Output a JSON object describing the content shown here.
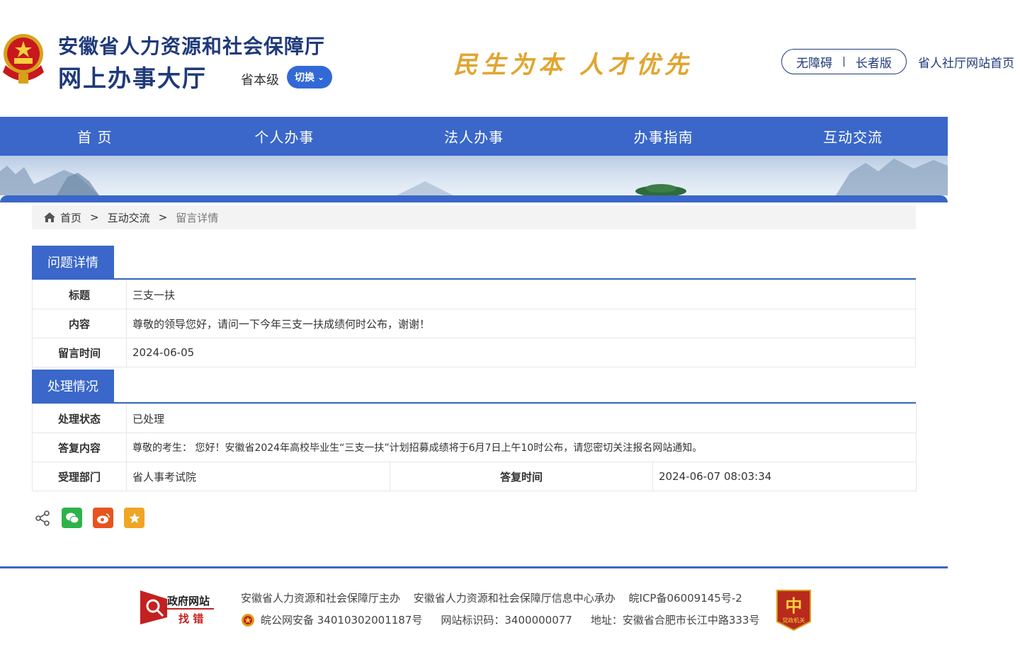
{
  "header": {
    "title_line1": "安徽省人力资源和社会保障厅",
    "title_line2": "网上办事大厅",
    "level_label": "省本级",
    "switch_label": "切换",
    "slogan": "民生为本 人才优先",
    "accessibility_label": "无障碍",
    "elder_label": "长者版",
    "site_home_link": "省人社厅网站首页"
  },
  "nav": {
    "items": [
      "首 页",
      "个人办事",
      "法人办事",
      "办事指南",
      "互动交流"
    ]
  },
  "breadcrumb": {
    "home": "首页",
    "level2": "互动交流",
    "current": "留言详情",
    "separator": ">"
  },
  "question": {
    "section_title": "问题详情",
    "title_label": "标题",
    "title_value": "三支一扶",
    "content_label": "内容",
    "content_value": "尊敬的领导您好，请问一下今年三支一扶成绩何时公布，谢谢！",
    "time_label": "留言时间",
    "time_value": "2024-06-05"
  },
  "handling": {
    "section_title": "处理情况",
    "status_label": "处理状态",
    "status_value": "已处理",
    "reply_label": "答复内容",
    "reply_value": "尊敬的考生： 您好！安徽省2024年高校毕业生“三支一扶”计划招募成绩将于6月7日上午10时公布，请您密切关注报名网站通知。",
    "dept_label": "受理部门",
    "dept_value": "省人事考试院",
    "reply_time_label": "答复时间",
    "reply_time_value": "2024-06-07 08:03:34"
  },
  "share": {
    "icons": [
      "share-icon",
      "wechat-icon",
      "weibo-icon",
      "favorite-icon"
    ]
  },
  "footer": {
    "gov_badge_line1": "政府网站",
    "gov_badge_line2": "找 错",
    "line1": "安徽省人力资源和社会保障厅主办 安徽省人力资源和社会保障厅信息中心承办 皖ICP备06009145号-2",
    "police_record": "皖公网安备 34010302001187号",
    "site_code": "网站标识码：3400000077",
    "address": "地址：安徽省合肥市长江中路333号",
    "party_badge_text": "党政机关"
  },
  "colors": {
    "primary": "#3a67c9",
    "title": "#1f3a7a",
    "slogan": "#e0a530",
    "footer_red": "#c32121"
  }
}
